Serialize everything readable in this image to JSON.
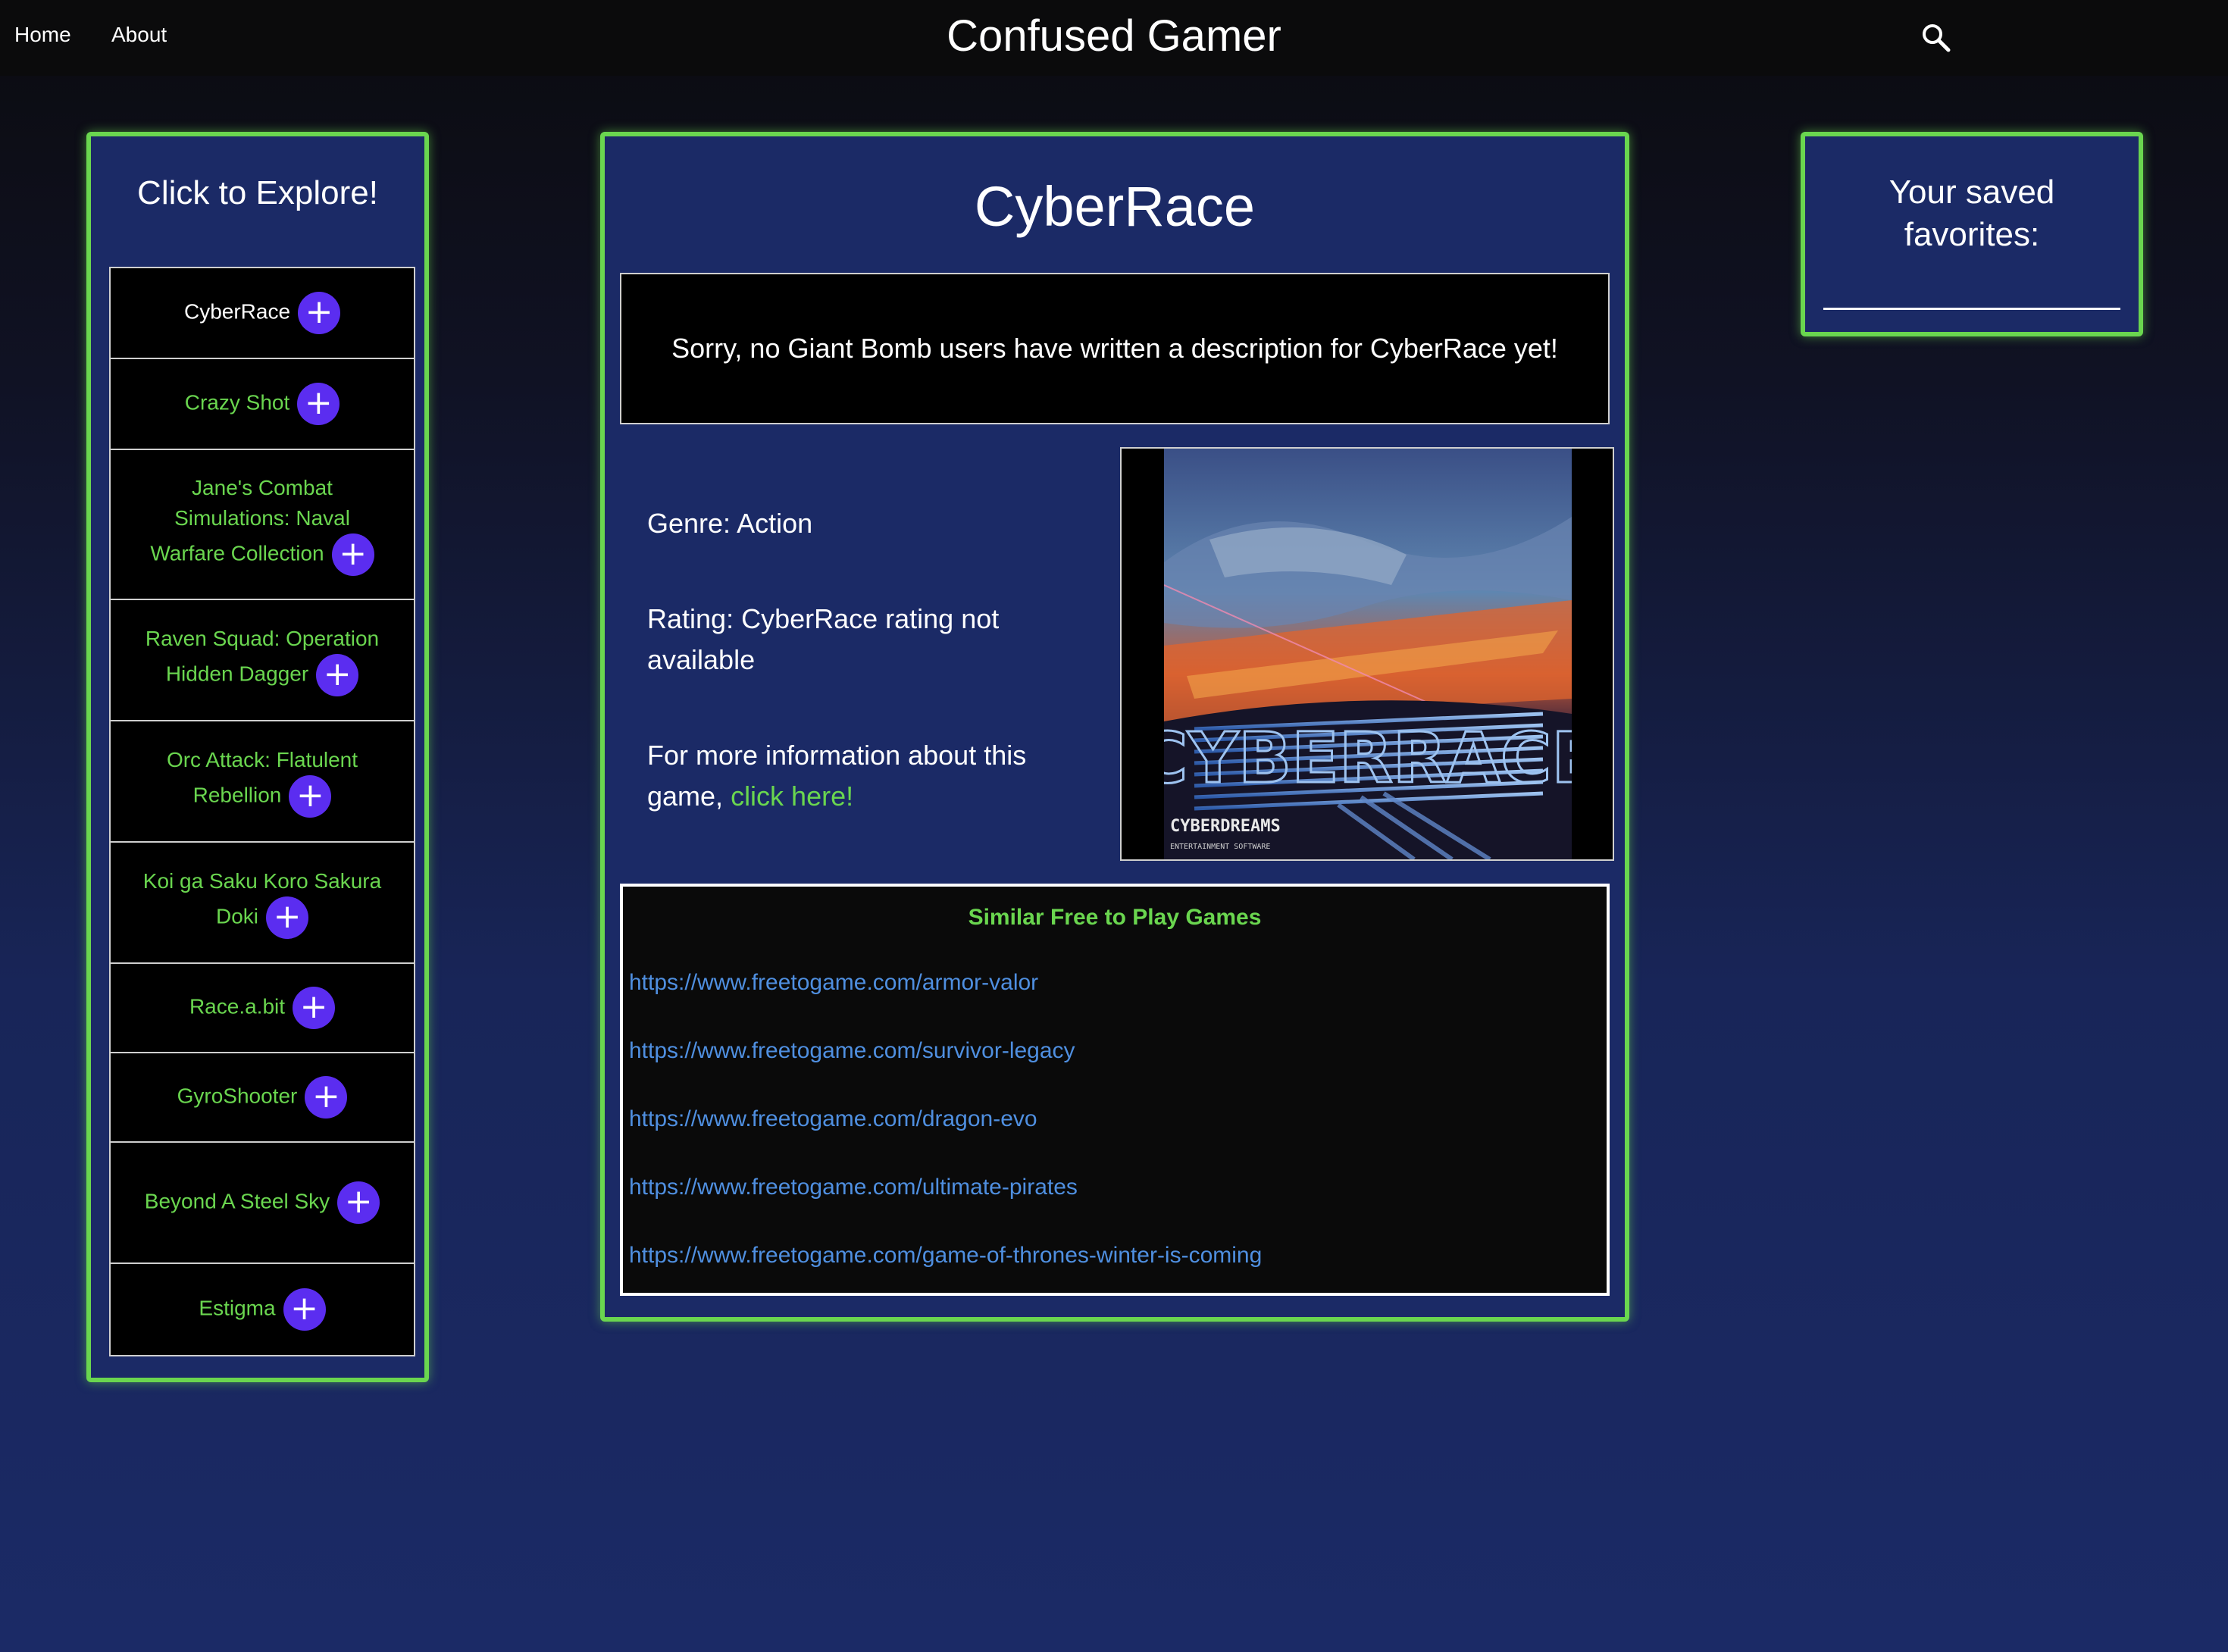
{
  "nav": {
    "home": "Home",
    "about": "About",
    "site_title": "Confused Gamer",
    "search_icon": "search-icon"
  },
  "explore": {
    "title": "Click to Explore!",
    "add_symbol": "+",
    "games": [
      {
        "name": "CyberRace",
        "active": true
      },
      {
        "name": "Crazy Shot"
      },
      {
        "name": "Jane's Combat Simulations: Naval Warfare Collection"
      },
      {
        "name": "Raven Squad: Operation Hidden Dagger"
      },
      {
        "name": "Orc Attack: Flatulent Rebellion"
      },
      {
        "name": "Koi ga Saku Koro Sakura Doki"
      },
      {
        "name": "Race.a.bit"
      },
      {
        "name": "GyroShooter"
      },
      {
        "name": "Beyond A Steel Sky"
      },
      {
        "name": "Estigma"
      }
    ]
  },
  "game": {
    "title": "CyberRace",
    "description": "Sorry, no Giant Bomb users have written a description for CyberRace yet!",
    "genre": "Genre: Action",
    "rating": "Rating: CyberRace rating not available",
    "more_info_prefix": "For more information about this game, ",
    "more_info_link": "click here!",
    "cover": {
      "logo_text": "CYBERRACE",
      "publisher_text": "CYBERDREAMS",
      "publisher_sub": "ENTERTAINMENT SOFTWARE"
    }
  },
  "similar": {
    "title": "Similar Free to Play Games",
    "links": [
      "https://www.freetogame.com/armor-valor",
      "https://www.freetogame.com/survivor-legacy",
      "https://www.freetogame.com/dragon-evo",
      "https://www.freetogame.com/ultimate-pirates",
      "https://www.freetogame.com/game-of-thrones-winter-is-coming"
    ]
  },
  "favorites": {
    "title": "Your saved favorites:"
  },
  "colors": {
    "accent_green": "#6ad64f",
    "panel_blue": "#1b2a66",
    "add_button_purple": "#5b2df0",
    "link_blue": "#4f8fe0"
  }
}
